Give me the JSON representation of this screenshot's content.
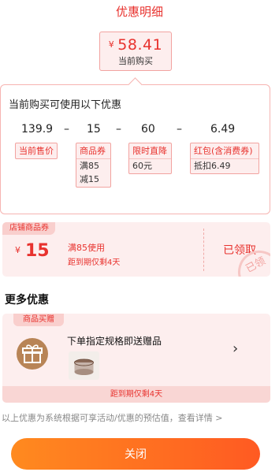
{
  "title": "优惠明细",
  "current_price": {
    "currency": "¥",
    "amount": "58.41",
    "caption": "当前购买"
  },
  "breakdown": {
    "title": "当前购买可使用以下优惠",
    "values": [
      "139.9",
      "–",
      "15",
      "–",
      "60",
      "–",
      "6.49"
    ],
    "tags": [
      {
        "head": "当前售价"
      },
      {
        "head": "商品券",
        "lines": [
          "满85",
          "减15"
        ]
      },
      {
        "head": "限时直降",
        "lines": [
          "60元"
        ]
      },
      {
        "head": "红包(含消费券)",
        "lines": [
          "抵扣6.49"
        ]
      }
    ]
  },
  "store_coupon": {
    "label": "店铺商品券",
    "currency": "¥",
    "amount": "15",
    "condition": "满85使用",
    "expiry": "距到期仅剩4天",
    "status": "已领取",
    "stamp": "已领"
  },
  "more": {
    "title": "更多优惠",
    "gift": {
      "label": "商品买赠",
      "description": "下单指定规格即送赠品",
      "arrow": "›",
      "expiry": "距到期仅剩4天"
    }
  },
  "note": "以上优惠为系统根据可享活动/优惠的预估值，查看详情 >",
  "close_label": "关闭",
  "colors": {
    "accent": "#e8322e",
    "button_start": "#ff8a1f",
    "button_end": "#ff5a22"
  }
}
